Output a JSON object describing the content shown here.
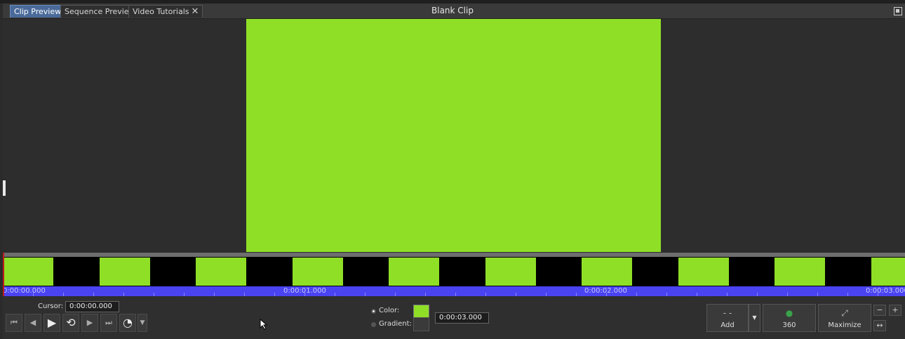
{
  "tabs": [
    {
      "label": "Clip Preview",
      "active": true
    },
    {
      "label": "Sequence Preview",
      "active": false
    },
    {
      "label": "Video Tutorials",
      "active": false,
      "closable": true
    }
  ],
  "window": {
    "title": "Blank Clip",
    "close_glyph": "✕"
  },
  "preview": {
    "clip_color": "#8fdf27",
    "background": "#2d2d2d"
  },
  "timeline": {
    "thumbnail_color": "#8fdf27",
    "thumbnail_count": 10,
    "labels": [
      "0:00:00.000",
      "0:00:01.000",
      "0:00:02.000",
      "0:00:03.000"
    ]
  },
  "controls": {
    "cursor_label": "Cursor:",
    "cursor_value": "0:00:00.000",
    "transport": [
      {
        "name": "go-to-start-icon",
        "glyph": "⏮"
      },
      {
        "name": "previous-frame-icon",
        "glyph": "◀"
      },
      {
        "name": "play-icon",
        "glyph": "▶"
      },
      {
        "name": "loop-icon",
        "glyph": "⟲"
      },
      {
        "name": "next-frame-icon",
        "glyph": "▶"
      },
      {
        "name": "go-to-end-icon",
        "glyph": "⏭"
      },
      {
        "name": "playback-speed-icon",
        "glyph": "◔"
      }
    ],
    "fill_options": [
      {
        "label": "Color:",
        "selected": true
      },
      {
        "label": "Gradient:",
        "selected": false
      }
    ],
    "color_swatch": "#8fdf27",
    "duration": "0:00:03.000",
    "add_label": "Add",
    "btn_360_label": "360",
    "maximize_label": "Maximize",
    "zoom_out_glyph": "−",
    "zoom_in_glyph": "+",
    "fit_glyph": "↔"
  }
}
